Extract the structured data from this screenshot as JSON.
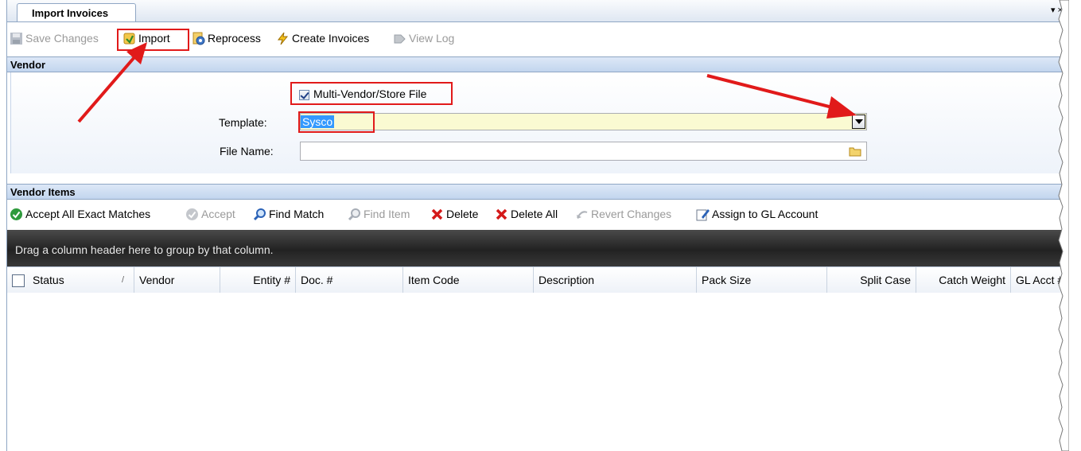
{
  "tab": {
    "title": "Import Invoices",
    "menu": "▾ ×"
  },
  "toolbar": {
    "save": "Save Changes",
    "import": "Import",
    "reprocess": "Reprocess",
    "create_invoices": "Create Invoices",
    "view_log": "View Log"
  },
  "vendor": {
    "header": "Vendor",
    "multi_vendor_label": "Multi-Vendor/Store File",
    "multi_vendor_checked": true,
    "template_label": "Template:",
    "template_value": "Sysco",
    "file_name_label": "File Name:",
    "file_name_value": ""
  },
  "vendor_items": {
    "header": "Vendor Items",
    "accept_all": "Accept All Exact Matches",
    "accept": "Accept",
    "find_match": "Find Match",
    "find_item": "Find Item",
    "delete": "Delete",
    "delete_all": "Delete All",
    "revert": "Revert Changes",
    "assign_gl": "Assign to GL Account"
  },
  "grid": {
    "group_hint": "Drag a column header here to group by that column.",
    "sort_glyph": "/",
    "columns": [
      "Status",
      "Vendor",
      "Entity #",
      "Doc. #",
      "Item Code",
      "Description",
      "Pack Size",
      "Split Case",
      "Catch Weight",
      "GL Acct #"
    ]
  },
  "colors": {
    "highlight_red": "#e11a1a",
    "header_blue": "#c2d5ee",
    "template_bg": "#fafad2"
  }
}
